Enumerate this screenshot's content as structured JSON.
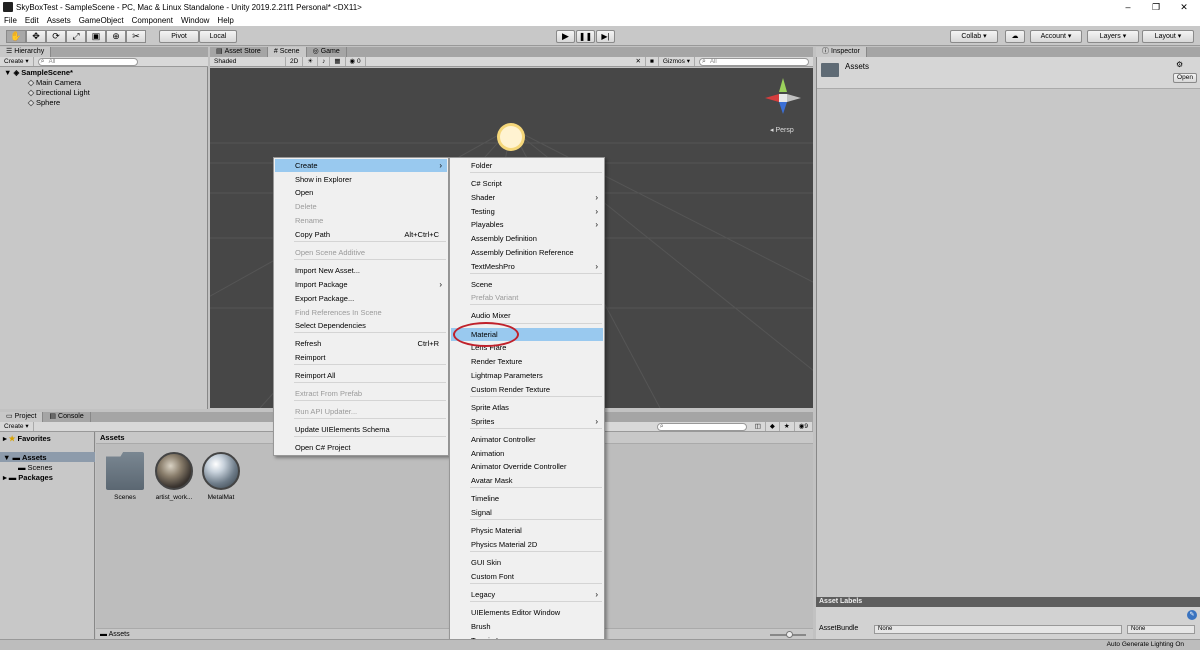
{
  "window": {
    "title": "SkyBoxTest - SampleScene - PC, Mac & Linux Standalone - Unity 2019.2.21f1 Personal* <DX11>",
    "minimize": "–",
    "maximize": "❐",
    "close": "✕"
  },
  "menu": [
    "File",
    "Edit",
    "Assets",
    "GameObject",
    "Component",
    "Window",
    "Help"
  ],
  "toolbar": {
    "pivot": "Pivot",
    "local": "Local",
    "collab": "Collab ▾",
    "account": "Account",
    "layers": "Layers",
    "layout": "Layout"
  },
  "hierarchy": {
    "tab": "Hierarchy",
    "create": "Create ▾",
    "search_placeholder": "All",
    "scene": "SampleScene*",
    "items": [
      "Main Camera",
      "Directional Light",
      "Sphere"
    ]
  },
  "scene_tabs": [
    {
      "label": "Asset Store"
    },
    {
      "label": "Scene"
    },
    {
      "label": "Game"
    }
  ],
  "scene_toolbar": {
    "shading": "Shaded",
    "mode2d": "2D",
    "fx_count": "0",
    "gizmos": "Gizmos ▾",
    "search_placeholder": "All",
    "persp": "Persp"
  },
  "inspector": {
    "tab": "Inspector",
    "title": "Assets",
    "open": "Open",
    "asset_labels": "Asset Labels",
    "asset_bundle": "AssetBundle",
    "bundle_value": "None",
    "variant_value": "None",
    "auto_lighting": "Auto Generate Lighting On"
  },
  "project": {
    "tab": "Project",
    "console_tab": "Console",
    "create": "Create ▾",
    "favorites": "Favorites",
    "assets": "Assets",
    "scenes": "Scenes",
    "packages": "Packages",
    "breadcrumb": "Assets",
    "footer_path": "Assets",
    "hidden_count": "9",
    "assets_items": [
      {
        "label": "Scenes"
      },
      {
        "label": "artist_work..."
      },
      {
        "label": "MetalMat"
      }
    ]
  },
  "context_menu": {
    "items": [
      {
        "label": "Create",
        "arrow": "›"
      },
      {
        "label": "Show in Explorer"
      },
      {
        "label": "Open"
      },
      {
        "label": "Delete"
      },
      {
        "label": "Rename"
      },
      {
        "label": "Copy Path",
        "shortcut": "Alt+Ctrl+C"
      },
      {
        "label": "Open Scene Additive"
      },
      {
        "label": "Import New Asset..."
      },
      {
        "label": "Import Package",
        "arrow": "›"
      },
      {
        "label": "Export Package..."
      },
      {
        "label": "Find References In Scene"
      },
      {
        "label": "Select Dependencies"
      },
      {
        "label": "Refresh",
        "shortcut": "Ctrl+R"
      },
      {
        "label": "Reimport"
      },
      {
        "label": "Reimport All"
      },
      {
        "label": "Extract From Prefab"
      },
      {
        "label": "Run API Updater..."
      },
      {
        "label": "Update UIElements Schema"
      },
      {
        "label": "Open C# Project"
      }
    ]
  },
  "create_submenu": {
    "items": [
      {
        "label": "Folder"
      },
      {
        "label": "C# Script"
      },
      {
        "label": "Shader",
        "arrow": "›"
      },
      {
        "label": "Testing",
        "arrow": "›"
      },
      {
        "label": "Playables",
        "arrow": "›"
      },
      {
        "label": "Assembly Definition"
      },
      {
        "label": "Assembly Definition Reference"
      },
      {
        "label": "TextMeshPro",
        "arrow": "›"
      },
      {
        "label": "Scene"
      },
      {
        "label": "Prefab Variant"
      },
      {
        "label": "Audio Mixer"
      },
      {
        "label": "Material"
      },
      {
        "label": "Lens Flare"
      },
      {
        "label": "Render Texture"
      },
      {
        "label": "Lightmap Parameters"
      },
      {
        "label": "Custom Render Texture"
      },
      {
        "label": "Sprite Atlas"
      },
      {
        "label": "Sprites",
        "arrow": "›"
      },
      {
        "label": "Animator Controller"
      },
      {
        "label": "Animation"
      },
      {
        "label": "Animator Override Controller"
      },
      {
        "label": "Avatar Mask"
      },
      {
        "label": "Timeline"
      },
      {
        "label": "Signal"
      },
      {
        "label": "Physic Material"
      },
      {
        "label": "Physics Material 2D"
      },
      {
        "label": "GUI Skin"
      },
      {
        "label": "Custom Font"
      },
      {
        "label": "Legacy",
        "arrow": "›"
      },
      {
        "label": "UIElements Editor Window"
      },
      {
        "label": "Brush"
      },
      {
        "label": "Terrain Layer"
      }
    ]
  },
  "colors": {
    "highlight": "#99c9ef",
    "annotation": "#c0212b",
    "scene_bg": "#474747"
  }
}
